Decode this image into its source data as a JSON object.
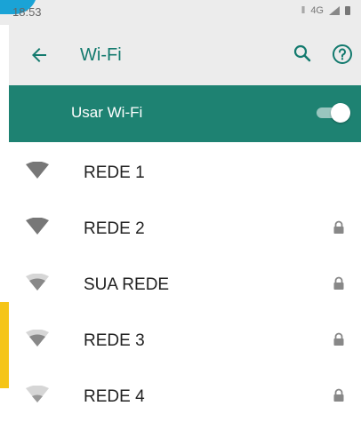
{
  "status_bar": {
    "time": "18:53",
    "network_type": "4G"
  },
  "app_bar": {
    "title": "Wi-Fi",
    "back_icon": "arrow-left-icon",
    "search_icon": "search-icon",
    "help_icon": "help-circle-icon"
  },
  "wifi_master": {
    "label": "Usar Wi-Fi",
    "enabled": true
  },
  "networks": [
    {
      "name": "REDE 1",
      "secured": false,
      "signal": "strong"
    },
    {
      "name": "REDE 2",
      "secured": true,
      "signal": "strong"
    },
    {
      "name": "SUA REDE",
      "secured": true,
      "signal": "medium"
    },
    {
      "name": "REDE 3",
      "secured": true,
      "signal": "medium"
    },
    {
      "name": "REDE 4",
      "secured": true,
      "signal": "weak"
    }
  ],
  "colors": {
    "accent": "#137a6e",
    "master_bar": "#1e8272",
    "app_bar": "#ececec",
    "wifi_strong": "#777777",
    "wifi_medium": "#a0a0a0"
  }
}
